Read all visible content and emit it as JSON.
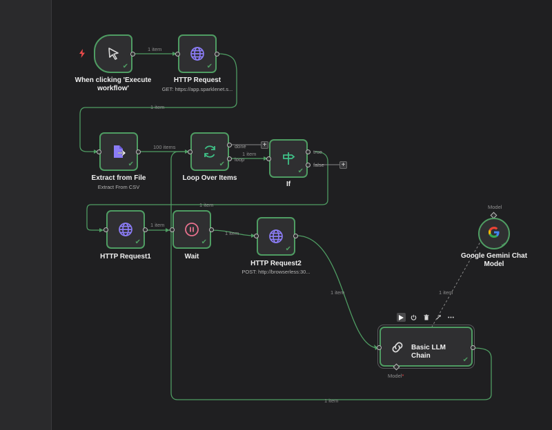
{
  "nodes": {
    "trigger": {
      "title_line1": "When clicking 'Execute",
      "title_line2": "workflow'"
    },
    "http": {
      "title": "HTTP Request",
      "subtitle": "GET: https://app.sparklenet.s..."
    },
    "extract": {
      "title": "Extract from File",
      "subtitle": "Extract From CSV"
    },
    "loop": {
      "title": "Loop Over Items",
      "out_done": "done",
      "out_loop": "loop"
    },
    "if": {
      "title": "If",
      "out_true": "true",
      "out_false": "false"
    },
    "http1": {
      "title": "HTTP Request1"
    },
    "wait": {
      "title": "Wait"
    },
    "http2": {
      "title": "HTTP Request2",
      "subtitle": "POST: http://browserless:30..."
    },
    "gemini": {
      "title_line1": "Google Gemini Chat",
      "title_line2": "Model",
      "port_label": "Model"
    },
    "llm": {
      "title": "Basic LLM Chain",
      "port_label": "Model",
      "required_mark": "*"
    }
  },
  "edges": {
    "e1": "1 item",
    "e2": "1 item",
    "e3": "100 items",
    "e4": "1 item",
    "e5": "1 item",
    "e6": "1 item",
    "e7": "1 item",
    "e8": "1 item",
    "e9": "1 item",
    "e10": "1 item"
  },
  "colors": {
    "background": "#1f1f21",
    "node_fill": "#2f2f31",
    "success_border": "#4f9d63",
    "wire": "#4f9d63",
    "icon_purple": "#8b7cf6",
    "icon_green": "#3fbf86",
    "wait_pink": "#e8718e",
    "trigger_red": "#ef4b4b"
  }
}
